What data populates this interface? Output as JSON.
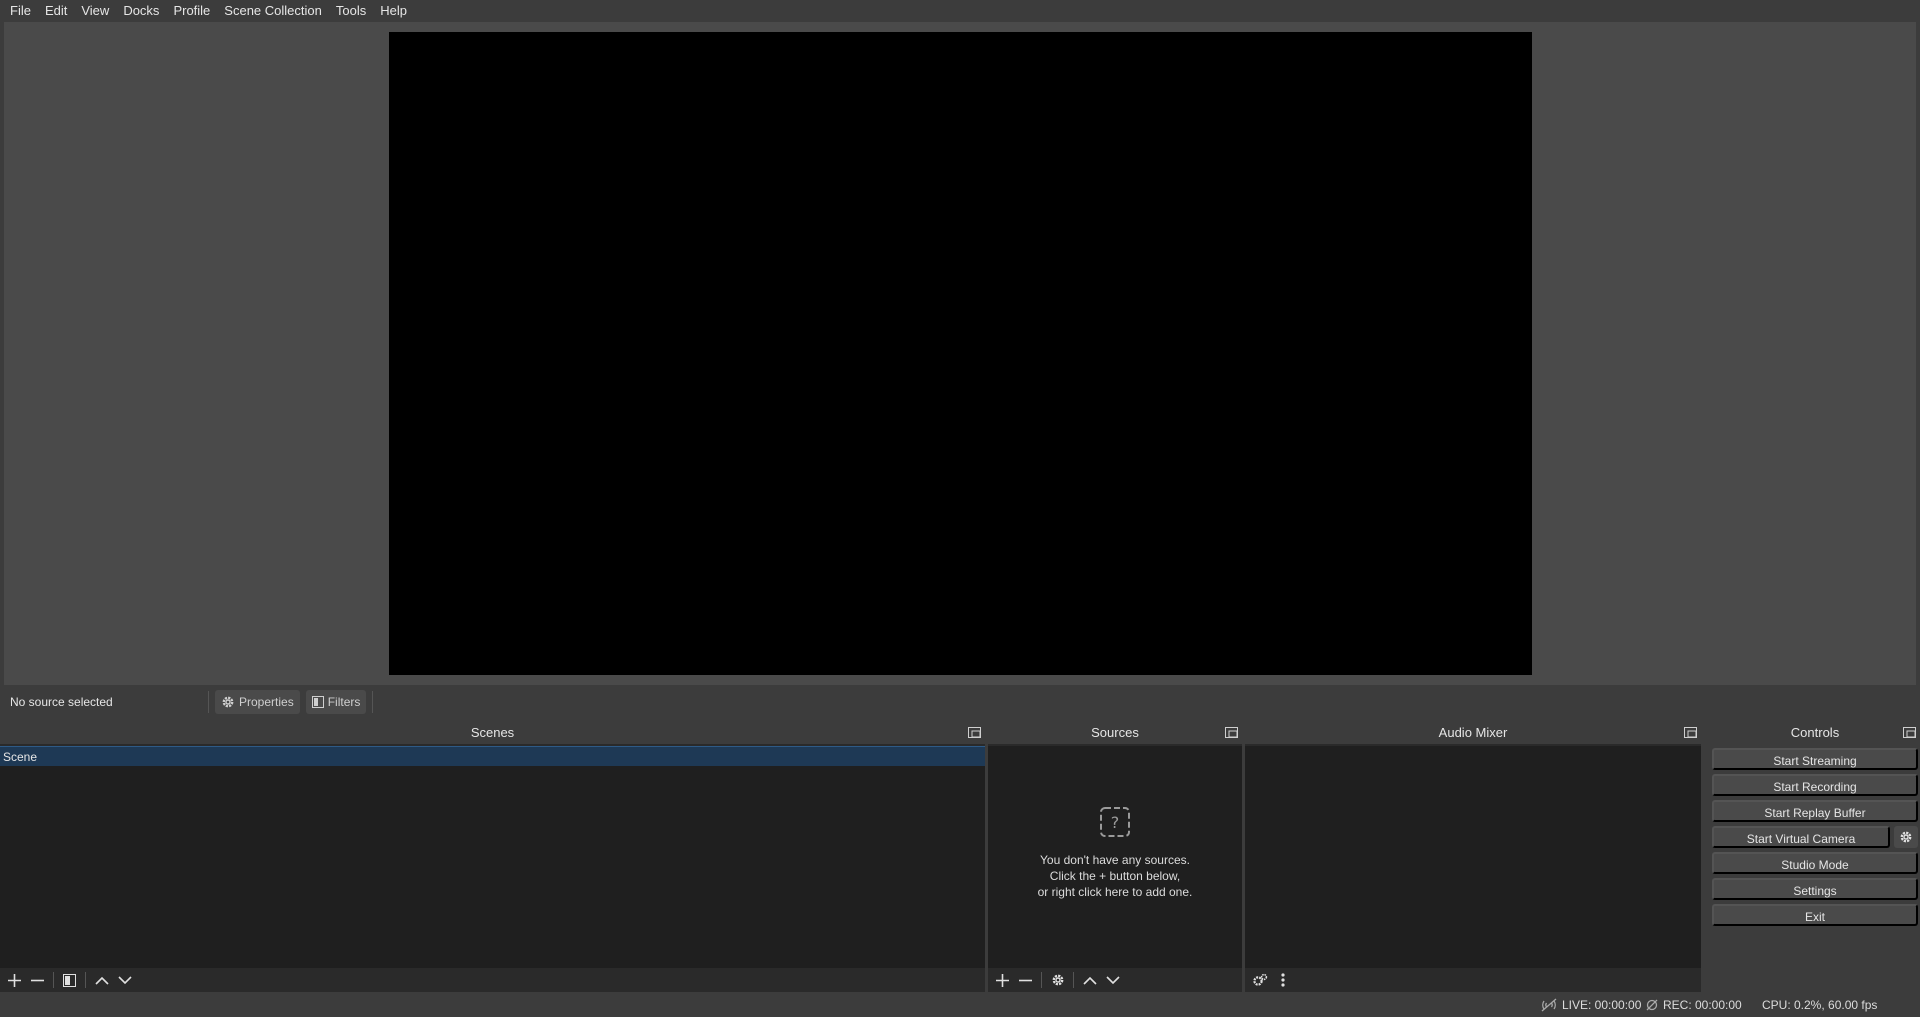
{
  "menu": [
    "File",
    "Edit",
    "View",
    "Docks",
    "Profile",
    "Scene Collection",
    "Tools",
    "Help"
  ],
  "context": {
    "source_label": "No source selected",
    "properties_label": "Properties",
    "filters_label": "Filters"
  },
  "docks": {
    "scenes": {
      "title": "Scenes",
      "items": [
        "Scene"
      ]
    },
    "sources": {
      "title": "Sources",
      "empty_line1": "You don't have any sources.",
      "empty_line2": "Click the + button below,",
      "empty_line3": "or right click here to add one."
    },
    "audio_mixer": {
      "title": "Audio Mixer"
    },
    "controls": {
      "title": "Controls",
      "start_streaming": "Start Streaming",
      "start_recording": "Start Recording",
      "start_replay_buffer": "Start Replay Buffer",
      "start_virtual_camera": "Start Virtual Camera",
      "studio_mode": "Studio Mode",
      "settings": "Settings",
      "exit": "Exit"
    }
  },
  "status": {
    "live": "LIVE: 00:00:00",
    "rec": "REC: 00:00:00",
    "cpu": "CPU: 0.2%, 60.00 fps"
  },
  "colors": {
    "background": "#3c3c3c",
    "panel": "#1f1f1f",
    "selected_scene": "#1e3955",
    "preview_canvas": "#000000"
  },
  "icons": {
    "float": "float-dock-icon",
    "gear": "gear-icon",
    "filters": "filters-icon",
    "add": "plus-icon",
    "remove": "minus-icon",
    "up": "chevron-up-icon",
    "down": "chevron-down-icon",
    "question": "question-icon"
  }
}
